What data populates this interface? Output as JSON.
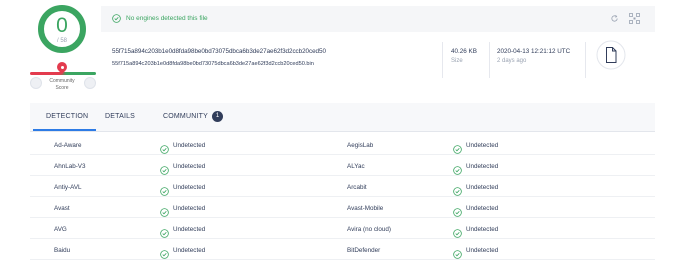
{
  "score": {
    "detections": "0",
    "total": "/ 58"
  },
  "community": {
    "label_line1": "Community",
    "label_line2": "Score"
  },
  "header": {
    "status_text": "No engines detected this file",
    "hash": "55f715a894c203b1e0d8fda98be0bd73075dbca6b3de27ae62f3d2ccb20ced50",
    "filename": "55f715a894c203b1e0d8fda98be0bd73075dbca6b3de27ae62f3d2ccb20ced50.bin",
    "size_value": "40.26 KB",
    "size_label": "Size",
    "date_value": "2020-04-13 12:21:12 UTC",
    "date_label": "2 days ago"
  },
  "tabs": {
    "detection": "DETECTION",
    "details": "DETAILS",
    "community": "COMMUNITY",
    "community_count": "1"
  },
  "colors": {
    "clean": "#3ba561",
    "malicious": "#e33b4e",
    "accent": "#2d7be5",
    "text": "#313d5a"
  },
  "rows": [
    {
      "left_engine": "Ad-Aware",
      "left_result": "Undetected",
      "right_engine": "AegisLab",
      "right_result": "Undetected"
    },
    {
      "left_engine": "AhnLab-V3",
      "left_result": "Undetected",
      "right_engine": "ALYac",
      "right_result": "Undetected"
    },
    {
      "left_engine": "Antiy-AVL",
      "left_result": "Undetected",
      "right_engine": "Arcabit",
      "right_result": "Undetected"
    },
    {
      "left_engine": "Avast",
      "left_result": "Undetected",
      "right_engine": "Avast-Mobile",
      "right_result": "Undetected"
    },
    {
      "left_engine": "AVG",
      "left_result": "Undetected",
      "right_engine": "Avira (no cloud)",
      "right_result": "Undetected"
    },
    {
      "left_engine": "Baidu",
      "left_result": "Undetected",
      "right_engine": "BitDefender",
      "right_result": "Undetected"
    }
  ]
}
